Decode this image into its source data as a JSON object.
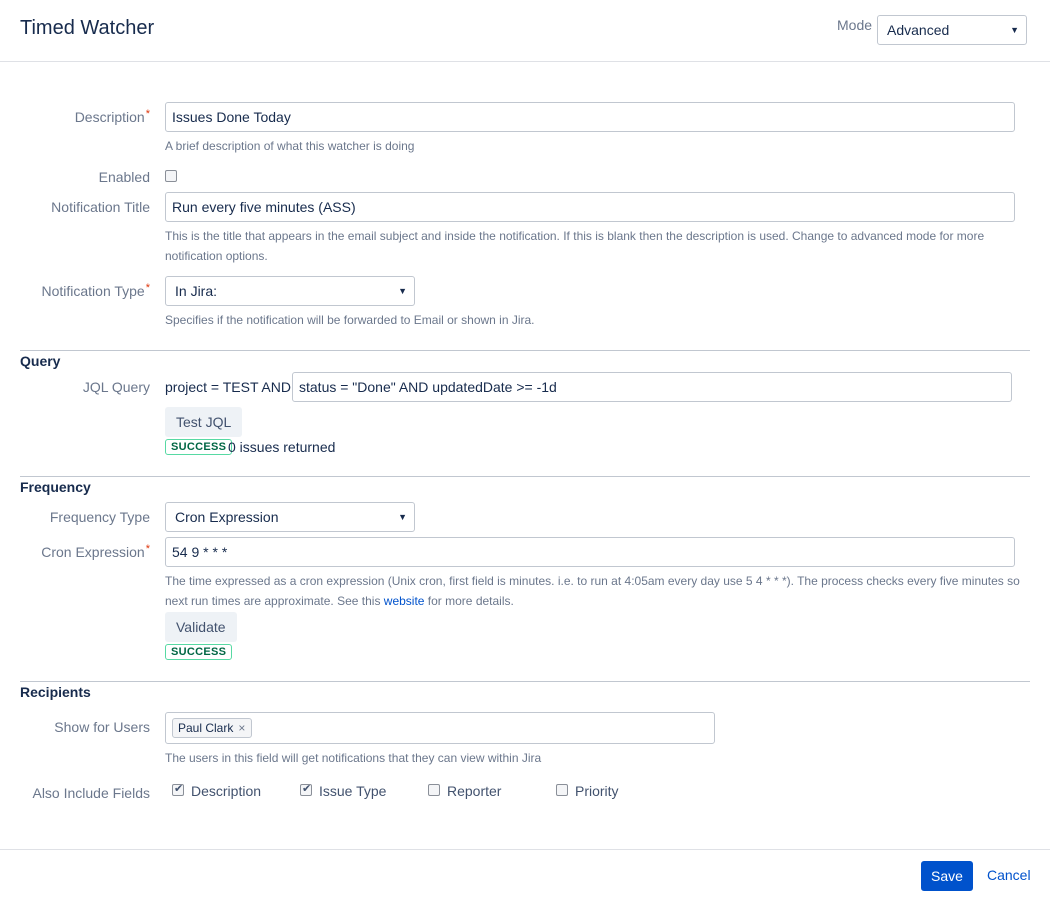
{
  "header": {
    "title": "Timed Watcher",
    "mode_label": "Mode",
    "mode_value": "Advanced"
  },
  "form": {
    "description": {
      "label": "Description",
      "value": "Issues Done Today",
      "help": "A brief description of what this watcher is doing"
    },
    "enabled": {
      "label": "Enabled",
      "checked": false
    },
    "notification_title": {
      "label": "Notification Title",
      "value": "Run every five minutes (ASS)",
      "help_line1": "This is the title that appears in the email subject and inside the notification. If this is blank then the description is used. Change to advanced mode for more",
      "help_line2": "notification options."
    },
    "notification_type": {
      "label": "Notification Type",
      "value": "In Jira:",
      "help": "Specifies if the notification will be forwarded to Email or shown in Jira."
    }
  },
  "query": {
    "section_title": "Query",
    "jql_label": "JQL Query",
    "jql_prefix": "project = TEST AND",
    "jql_value": "status = \"Done\" AND updatedDate >= -1d",
    "test_button": "Test JQL",
    "status_badge": "SUCCESS",
    "result_text": "0 issues returned"
  },
  "frequency": {
    "section_title": "Frequency",
    "type_label": "Frequency Type",
    "type_value": "Cron Expression",
    "cron_label": "Cron Expression",
    "cron_value": "54 9 * * *",
    "help_line1": "The time expressed as a cron expression (Unix cron, first field is minutes. i.e. to run at 4:05am every day use 5 4 * * *). The process checks every five minutes so",
    "help_line2_pre": "next run times are approximate. See this ",
    "help_link": "website",
    "help_line2_post": " for more details.",
    "validate_button": "Validate",
    "status_badge": "SUCCESS"
  },
  "recipients": {
    "section_title": "Recipients",
    "show_users_label": "Show for Users",
    "user_tag": "Paul Clark",
    "remove_glyph": "×",
    "users_help": "The users in this field will get notifications that they can view within Jira",
    "include_fields_label": "Also Include Fields",
    "fields": [
      {
        "label": "Description",
        "checked": true
      },
      {
        "label": "Issue Type",
        "checked": true
      },
      {
        "label": "Reporter",
        "checked": false
      },
      {
        "label": "Priority",
        "checked": false
      }
    ]
  },
  "footer": {
    "save_label": "Save",
    "cancel_label": "Cancel"
  },
  "icons": {
    "caret": "▼",
    "required": "*"
  },
  "colors": {
    "primary": "#0052cc",
    "required": "#de350b",
    "success": "#006644"
  }
}
